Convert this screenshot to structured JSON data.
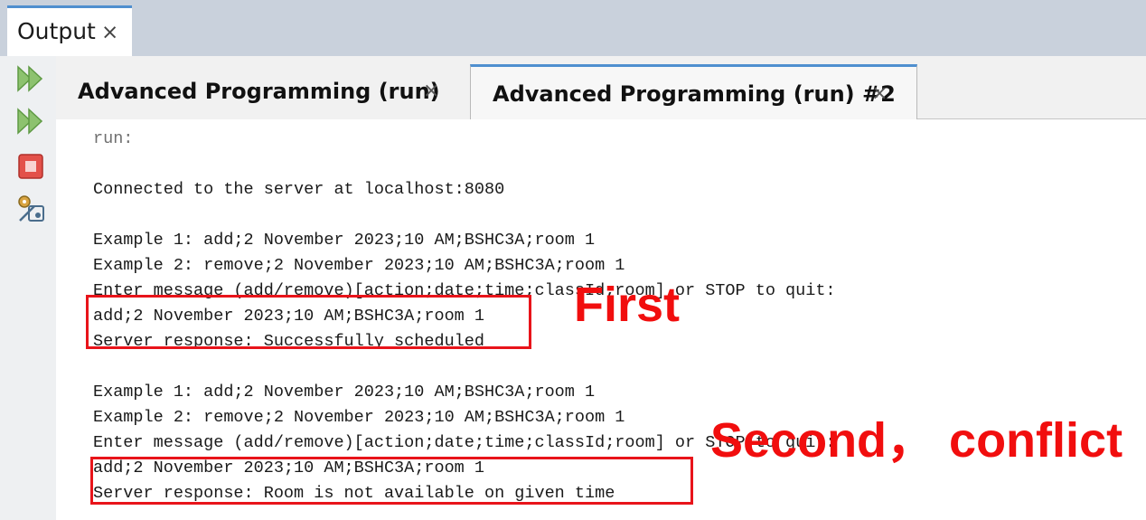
{
  "panel": {
    "title": "Output",
    "close_glyph": "×"
  },
  "toolbar": {
    "buttons": [
      {
        "icon": "rerun-icon"
      },
      {
        "icon": "rerun-with-options-icon"
      },
      {
        "icon": "stop-icon"
      },
      {
        "icon": "settings-icon"
      }
    ]
  },
  "tabs": [
    {
      "label": "Advanced Programming (run)",
      "close_glyph": "×",
      "active": false
    },
    {
      "label": "Advanced Programming (run) #2",
      "close_glyph": "×",
      "active": true
    }
  ],
  "console": {
    "lines": [
      "run:",
      "Connected to the server at localhost:8080",
      "Example 1: add;2 November 2023;10 AM;BSHC3A;room 1",
      "Example 2: remove;2 November 2023;10 AM;BSHC3A;room 1",
      "Enter message (add/remove)[action;date;time;classId;room] or STOP to quit:",
      "add;2 November 2023;10 AM;BSHC3A;room 1",
      "Server response: Successfully scheduled",
      "Example 1: add;2 November 2023;10 AM;BSHC3A;room 1",
      "Example 2: remove;2 November 2023;10 AM;BSHC3A;room 1",
      "Enter message (add/remove)[action;date;time;classId;room] or STOP to quit:",
      "add;2 November 2023;10 AM;BSHC3A;room 1",
      "Server response: Room is not available on given time"
    ]
  },
  "annotations": {
    "first": "First",
    "second": "Second， conflict"
  },
  "colors": {
    "annotation_red": "#e8141a",
    "active_tab_accent": "#4f8fcf"
  }
}
